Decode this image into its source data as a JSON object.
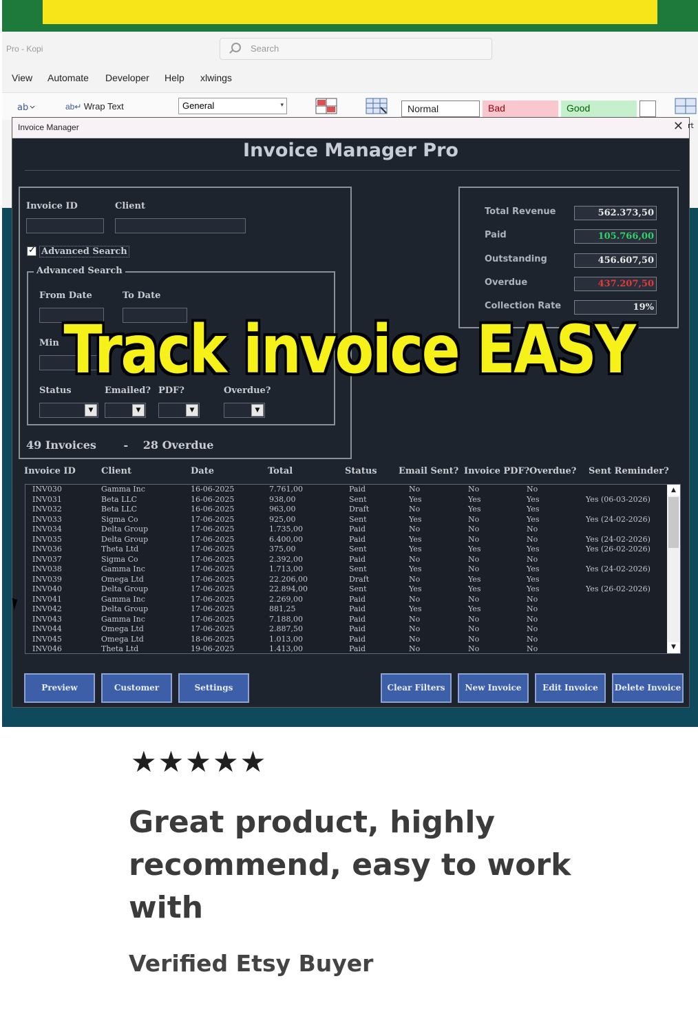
{
  "excel": {
    "titlebar_left": "Pro - Kopi",
    "search_placeholder": "Search",
    "ribbon_tabs": [
      "View",
      "Automate",
      "Developer",
      "Help",
      "xlwings"
    ],
    "wrap_text": "Wrap Text",
    "number_format": "General",
    "styles": {
      "normal": "Normal",
      "bad": "Bad",
      "good": "Good"
    },
    "right_edge_label": "rt"
  },
  "dialog": {
    "window_title": "Invoice Manager",
    "close_glyph": "✕",
    "app_title": "Invoice Manager Pro",
    "filters": {
      "invoice_id_label": "Invoice ID",
      "client_label": "Client",
      "advanced_checkbox_label": "Advanced Search",
      "advanced_checked": true,
      "advanced_group_title": "Advanced Search",
      "from_date_label": "From Date",
      "to_date_label": "To Date",
      "min_label": "Min",
      "status_label": "Status",
      "emailed_label": "Emailed?",
      "pdf_label": "PDF?",
      "overdue_label": "Overdue?"
    },
    "summary": {
      "rows": [
        {
          "label": "Total Revenue",
          "value": "562.373,50",
          "color": "#e8e8e8"
        },
        {
          "label": "Paid",
          "value": "105.766,00",
          "color": "#2fd16a"
        },
        {
          "label": "Outstanding",
          "value": "456.607,50",
          "color": "#e8e8e8"
        },
        {
          "label": "Overdue",
          "value": "437.207,50",
          "color": "#e23a3a"
        },
        {
          "label": "Collection Rate",
          "value": "19%",
          "color": "#e8e8e8"
        }
      ]
    },
    "counts": {
      "invoices": "49 Invoices",
      "separator": "-",
      "overdue": "28 Overdue"
    },
    "table": {
      "headers": [
        "Invoice ID",
        "Client",
        "Date",
        "Total",
        "Status",
        "Email Sent?",
        "Invoice PDF?",
        "Overdue?",
        "Sent Reminder?"
      ],
      "rows": [
        [
          "INV030",
          "Gamma Inc",
          "16-06-2025",
          "7.761,00",
          "Paid",
          "No",
          "No",
          "No",
          ""
        ],
        [
          "INV031",
          "Beta LLC",
          "16-06-2025",
          "938,00",
          "Sent",
          "Yes",
          "Yes",
          "Yes",
          "Yes (06-03-2026)"
        ],
        [
          "INV032",
          "Beta LLC",
          "16-06-2025",
          "963,00",
          "Draft",
          "No",
          "Yes",
          "Yes",
          ""
        ],
        [
          "INV033",
          "Sigma Co",
          "17-06-2025",
          "925,00",
          "Sent",
          "Yes",
          "No",
          "Yes",
          "Yes (24-02-2026)"
        ],
        [
          "INV034",
          "Delta Group",
          "17-06-2025",
          "1.735,00",
          "Paid",
          "No",
          "No",
          "No",
          ""
        ],
        [
          "INV035",
          "Delta Group",
          "17-06-2025",
          "6.400,00",
          "Paid",
          "Yes",
          "No",
          "No",
          "Yes (24-02-2026)"
        ],
        [
          "INV036",
          "Theta Ltd",
          "17-06-2025",
          "375,00",
          "Sent",
          "Yes",
          "Yes",
          "Yes",
          "Yes (26-02-2026)"
        ],
        [
          "INV037",
          "Sigma Co",
          "17-06-2025",
          "2.392,00",
          "Paid",
          "No",
          "No",
          "No",
          ""
        ],
        [
          "INV038",
          "Gamma Inc",
          "17-06-2025",
          "1.713,00",
          "Sent",
          "Yes",
          "No",
          "Yes",
          "Yes (24-02-2026)"
        ],
        [
          "INV039",
          "Omega Ltd",
          "17-06-2025",
          "22.206,00",
          "Draft",
          "No",
          "Yes",
          "Yes",
          ""
        ],
        [
          "INV040",
          "Delta Group",
          "17-06-2025",
          "22.894,00",
          "Sent",
          "Yes",
          "Yes",
          "Yes",
          "Yes (26-02-2026)"
        ],
        [
          "INV041",
          "Gamma Inc",
          "17-06-2025",
          "2.269,00",
          "Paid",
          "No",
          "No",
          "No",
          ""
        ],
        [
          "INV042",
          "Delta Group",
          "17-06-2025",
          "881,25",
          "Paid",
          "Yes",
          "Yes",
          "No",
          ""
        ],
        [
          "INV043",
          "Gamma Inc",
          "17-06-2025",
          "7.188,00",
          "Paid",
          "No",
          "No",
          "No",
          ""
        ],
        [
          "INV044",
          "Omega Ltd",
          "17-06-2025",
          "2.887,50",
          "Paid",
          "No",
          "No",
          "No",
          ""
        ],
        [
          "INV045",
          "Omega Ltd",
          "18-06-2025",
          "1.013,00",
          "Paid",
          "No",
          "No",
          "No",
          ""
        ],
        [
          "INV046",
          "Theta Ltd",
          "19-06-2025",
          "1.413,00",
          "Paid",
          "No",
          "No",
          "No",
          ""
        ]
      ]
    },
    "buttons": {
      "preview": "Preview",
      "customer": "Customer",
      "settings": "Settings",
      "clear_filters": "Clear Filters",
      "new_invoice": "New Invoice",
      "edit_invoice": "Edit Invoice",
      "delete_invoice": "Delete Invoice"
    }
  },
  "overlay_caption": "Track invoice EASY",
  "review": {
    "stars": "★★★★★",
    "rating": 5,
    "text": "Great product, highly recommend, easy to work with",
    "author": "Verified Etsy Buyer"
  },
  "colors": {
    "dialog_bg": "#1e242e",
    "button_blue": "#3d5fa8",
    "caption_yellow": "#f7f11a",
    "excel_green": "#1e7a3b"
  }
}
